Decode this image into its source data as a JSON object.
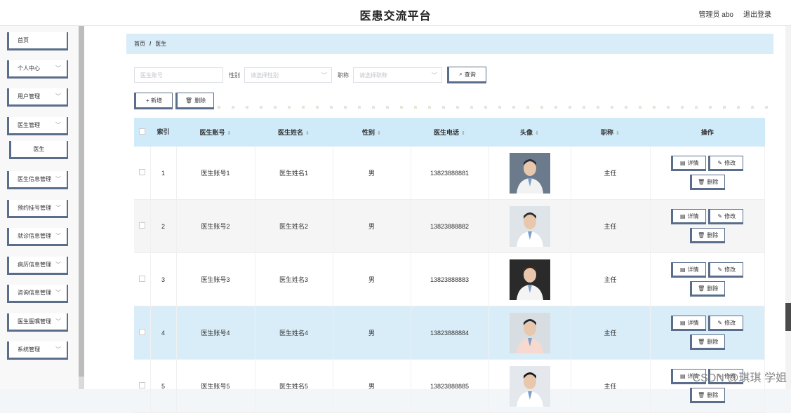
{
  "header": {
    "title": "医患交流平台",
    "user_label": "管理员 abo",
    "logout_label": "退出登录"
  },
  "sidebar": {
    "items": [
      {
        "label": "首页",
        "has_chevron": false
      },
      {
        "label": "个人中心",
        "has_chevron": true
      },
      {
        "label": "用户管理",
        "has_chevron": true
      },
      {
        "label": "医生管理",
        "has_chevron": true
      },
      {
        "label": "医生",
        "sub": true
      },
      {
        "label": "医生信息管理",
        "has_chevron": true
      },
      {
        "label": "预约挂号管理",
        "has_chevron": true
      },
      {
        "label": "就诊信息管理",
        "has_chevron": true
      },
      {
        "label": "病历信息管理",
        "has_chevron": true
      },
      {
        "label": "咨询信息管理",
        "has_chevron": true
      },
      {
        "label": "医生医嘱管理",
        "has_chevron": true
      },
      {
        "label": "系统管理",
        "has_chevron": true
      }
    ]
  },
  "breadcrumb": {
    "home": "首页",
    "separator": "/",
    "current": "医生"
  },
  "search": {
    "account_placeholder": "医生账号",
    "gender_label": "性别",
    "gender_placeholder": "请选择性别",
    "title_label": "职称",
    "title_placeholder": "请选择职称",
    "query_label": "查询"
  },
  "actions": {
    "add_label": "+ 新增",
    "delete_label": "删除"
  },
  "table": {
    "headers": {
      "index": "索引",
      "account": "医生账号",
      "name": "医生姓名",
      "gender": "性别",
      "phone": "医生电话",
      "avatar": "头像",
      "title": "职称",
      "ops": "操作"
    },
    "detail_label": "详情",
    "edit_label": "修改",
    "delete_label": "删除",
    "rows": [
      {
        "index": "1",
        "account": "医生账号1",
        "name": "医生姓名1",
        "gender": "男",
        "phone": "13823888881",
        "title": "主任"
      },
      {
        "index": "2",
        "account": "医生账号2",
        "name": "医生姓名2",
        "gender": "男",
        "phone": "13823888882",
        "title": "主任"
      },
      {
        "index": "3",
        "account": "医生账号3",
        "name": "医生姓名3",
        "gender": "男",
        "phone": "13823888883",
        "title": "主任"
      },
      {
        "index": "4",
        "account": "医生账号4",
        "name": "医生姓名4",
        "gender": "男",
        "phone": "13823888884",
        "title": "主任"
      },
      {
        "index": "5",
        "account": "医生账号5",
        "name": "医生姓名5",
        "gender": "男",
        "phone": "13823888885",
        "title": "主任"
      }
    ]
  },
  "watermark": "CSDN @琪琪 学姐",
  "colors": {
    "accent": "#5a6d8a",
    "header_bg": "#cfeaf8",
    "breadcrumb_bg": "#d9edf8"
  }
}
